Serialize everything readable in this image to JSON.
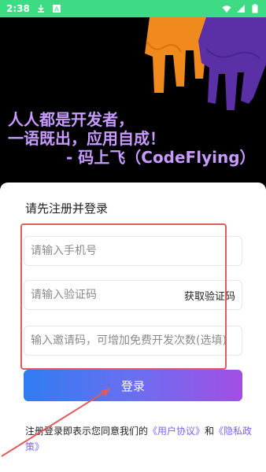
{
  "status_bar": {
    "time": "2:38",
    "icons_left": [
      "download-icon",
      "font-icon"
    ],
    "icons_right": [
      "wifi-icon",
      "signal-icon",
      "battery-icon"
    ]
  },
  "slogan": {
    "line1": "人人都是开发者，",
    "line2": "一语既出，应用自成！",
    "line3": "- 码上飞（CodeFlying）"
  },
  "login_sheet": {
    "title": "请先注册并登录",
    "phone_placeholder": "请输入手机号",
    "code_placeholder": "请输入验证码",
    "get_code_label": "获取验证码",
    "invite_placeholder": "输入邀请码，可增加免费开发次数(选填)",
    "login_button_label": "登录",
    "agreement": {
      "prefix": "注册登录即表示您同意我们的",
      "user_agreement": "《用户协议》",
      "and": "和",
      "privacy_policy": "《隐私政策》"
    }
  },
  "colors": {
    "status_bar": "#3ddc84",
    "slogan": "#c79bff",
    "highlight": "#e25b5b",
    "link": "#7b62ff",
    "button_gradient": [
      "#2f7cf0",
      "#a24fe3"
    ]
  }
}
